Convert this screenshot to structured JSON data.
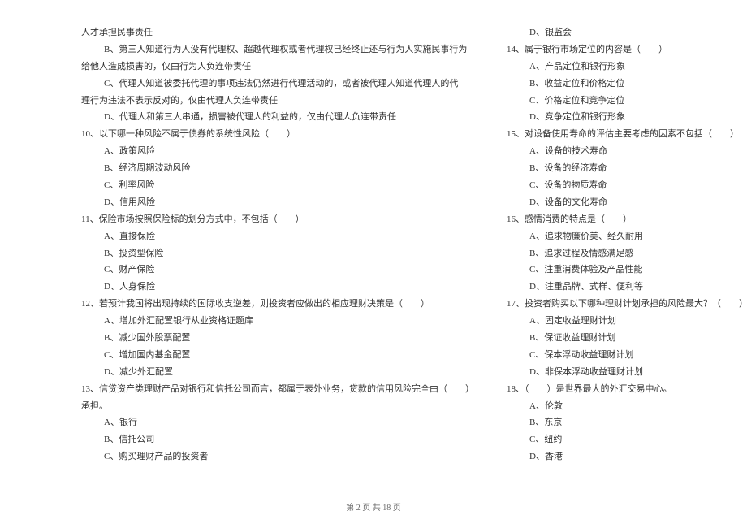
{
  "left": {
    "l1": "人才承担民事责任",
    "l2": "B、第三人知道行为人没有代理权、超越代理权或者代理权已经终止还与行为人实施民事行为",
    "l3": "给他人造成损害的，仅由行为人负连带责任",
    "l4": "C、代理人知道被委托代理的事项违法仍然进行代理活动的，或者被代理人知道代理人的代",
    "l5": "理行为违法不表示反对的，仅由代理人负连带责任",
    "l6": "D、代理人和第三人串通，损害被代理人的利益的，仅由代理人负连带责任",
    "q10": "10、以下哪一种风险不属于债券的系统性风险（　　）",
    "q10a": "A、政策风险",
    "q10b": "B、经济周期波动风险",
    "q10c": "C、利率风险",
    "q10d": "D、信用风险",
    "q11": "11、保险市场按照保险标的划分方式中，不包括（　　）",
    "q11a": "A、直接保险",
    "q11b": "B、投资型保险",
    "q11c": "C、财产保险",
    "q11d": "D、人身保险",
    "q12": "12、若预计我国将出现持续的国际收支逆差，则投资者应做出的相应理财决策是（　　）",
    "q12a": "A、增加外汇配置银行从业资格证题库",
    "q12b": "B、减少国外股票配置",
    "q12c": "C、增加国内基金配置",
    "q12d": "D、减少外汇配置",
    "q13": "13、信贷资产类理财产品对银行和信托公司而言，都属于表外业务，贷款的信用风险完全由（　　）",
    "q13t": "承担。",
    "q13a": "A、银行",
    "q13b": "B、信托公司",
    "q13c": "C、购买理财产品的投资者"
  },
  "right": {
    "q13d": "D、银监会",
    "q14": "14、属于银行市场定位的内容是（　　）",
    "q14a": "A、产品定位和银行形象",
    "q14b": "B、收益定位和价格定位",
    "q14c": "C、价格定位和竞争定位",
    "q14d": "D、竞争定位和银行形象",
    "q15": "15、对设备使用寿命的评估主要考虑的因素不包括（　　）",
    "q15a": "A、设备的技术寿命",
    "q15b": "B、设备的经济寿命",
    "q15c": "C、设备的物质寿命",
    "q15d": "D、设备的文化寿命",
    "q16": "16、感情消费的特点是（　　）",
    "q16a": "A、追求物廉价美、经久耐用",
    "q16b": "B、追求过程及情感满足感",
    "q16c": "C、注重消费体验及产品性能",
    "q16d": "D、注重品牌、式样、便利等",
    "q17": "17、投资者购买以下哪种理财计划承担的风险最大？（　　）",
    "q17a": "A、固定收益理财计划",
    "q17b": "B、保证收益理财计划",
    "q17c": "C、保本浮动收益理财计划",
    "q17d": "D、非保本浮动收益理财计划",
    "q18": "18、（　　）是世界最大的外汇交易中心。",
    "q18a": "A、伦敦",
    "q18b": "B、东京",
    "q18c": "C、纽约",
    "q18d": "D、香港"
  },
  "footer": "第 2 页 共 18 页"
}
